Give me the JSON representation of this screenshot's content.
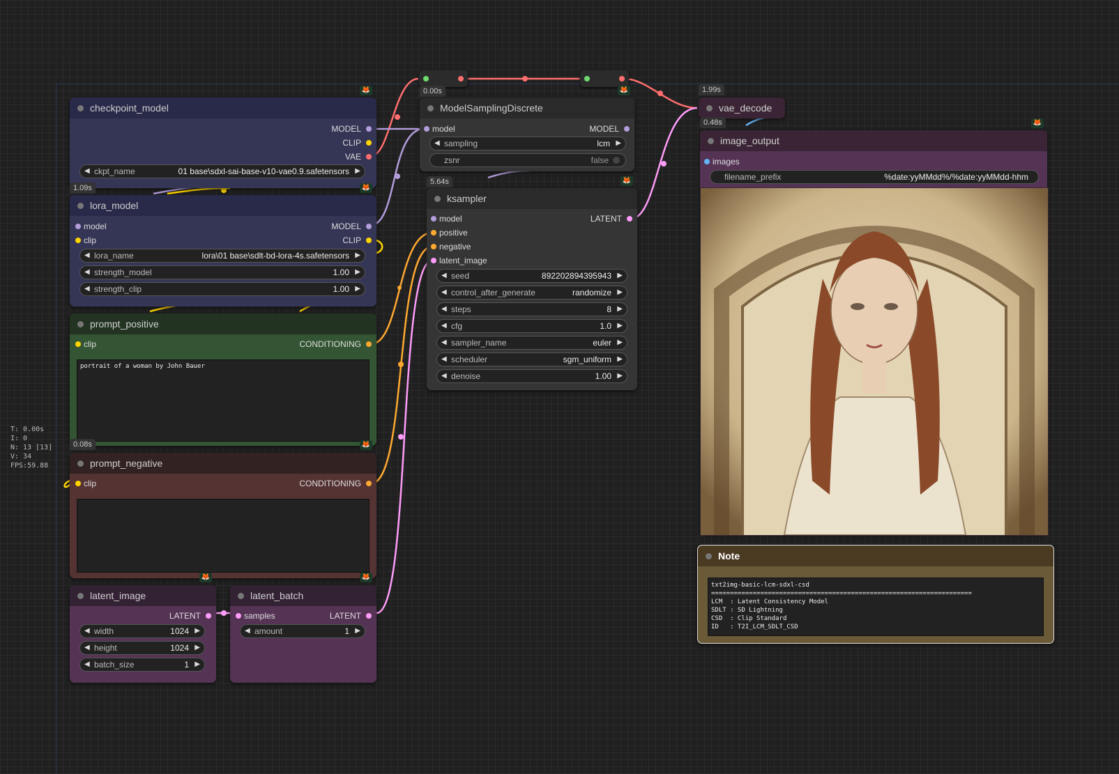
{
  "stats": {
    "t": "T: 0.00s",
    "i": "I: 0",
    "n": "N: 13 [13]",
    "v": "V: 34",
    "fps": "FPS:59.88"
  },
  "timings": {
    "model_sampling": "0.00s",
    "checkpoint": "1.09s",
    "lora": "0.08s",
    "prompt_positive": "0.08s",
    "ksampler": "5.64s",
    "vae_decode": "1.99s",
    "image_output": "0.48s"
  },
  "badge_icon": "fox-badge-icon",
  "checkpoint_model": {
    "title": "checkpoint_model",
    "outputs": [
      "MODEL",
      "CLIP",
      "VAE"
    ],
    "ckpt_name_label": "ckpt_name",
    "ckpt_name_value": "01 base\\sdxl-sai-base-v10-vae0.9.safetensors"
  },
  "lora_model": {
    "title": "lora_model",
    "in_model": "model",
    "in_clip": "clip",
    "out_model": "MODEL",
    "out_clip": "CLIP",
    "widgets": [
      {
        "label": "lora_name",
        "value": "lora\\01 base\\sdlt-bd-lora-4s.safetensors"
      },
      {
        "label": "strength_model",
        "value": "1.00"
      },
      {
        "label": "strength_clip",
        "value": "1.00"
      }
    ]
  },
  "prompt_positive": {
    "title": "prompt_positive",
    "in_clip": "clip",
    "out": "CONDITIONING",
    "text": "portrait of a woman by John Bauer"
  },
  "prompt_negative": {
    "title": "prompt_negative",
    "in_clip": "clip",
    "out": "CONDITIONING",
    "text": ""
  },
  "latent_image": {
    "title": "latent_image",
    "out": "LATENT",
    "widgets": [
      {
        "label": "width",
        "value": "1024"
      },
      {
        "label": "height",
        "value": "1024"
      },
      {
        "label": "batch_size",
        "value": "1"
      }
    ]
  },
  "latent_batch": {
    "title": "latent_batch",
    "in": "samples",
    "out": "LATENT",
    "amount_label": "amount",
    "amount_value": "1"
  },
  "model_sampling": {
    "title": "ModelSamplingDiscrete",
    "in": "model",
    "out": "MODEL",
    "sampling_label": "sampling",
    "sampling_value": "lcm",
    "zsnr_label": "zsnr",
    "zsnr_value": "false"
  },
  "ksampler": {
    "title": "ksampler",
    "inputs": [
      "model",
      "positive",
      "negative",
      "latent_image"
    ],
    "out": "LATENT",
    "widgets": [
      {
        "label": "seed",
        "value": "892202894395943"
      },
      {
        "label": "control_after_generate",
        "value": "randomize"
      },
      {
        "label": "steps",
        "value": "8"
      },
      {
        "label": "cfg",
        "value": "1.0"
      },
      {
        "label": "sampler_name",
        "value": "euler"
      },
      {
        "label": "scheduler",
        "value": "sgm_uniform"
      },
      {
        "label": "denoise",
        "value": "1.00"
      }
    ]
  },
  "vae_decode": {
    "title": "vae_decode"
  },
  "image_output": {
    "title": "image_output",
    "in": "images",
    "prefix_label": "filename_prefix",
    "prefix_value": "%date:yyMMdd%/%date:yyMMdd-hhm"
  },
  "note": {
    "title": "Note",
    "text": "txt2img-basic-lcm-sdxl-csd\n=====================================================================\nLCM  : Latent Consistency Model\nSDLT : SD Lightning\nCSD  : Clip Standard\nID   : T2I_LCM_SDLT_CSD"
  },
  "colors": {
    "model": "#b39ddb",
    "clip": "#ffd500",
    "vae": "#ff6e6e",
    "conditioning": "#ffa931",
    "latent": "#ff9cf9",
    "image": "#64b5f6"
  }
}
